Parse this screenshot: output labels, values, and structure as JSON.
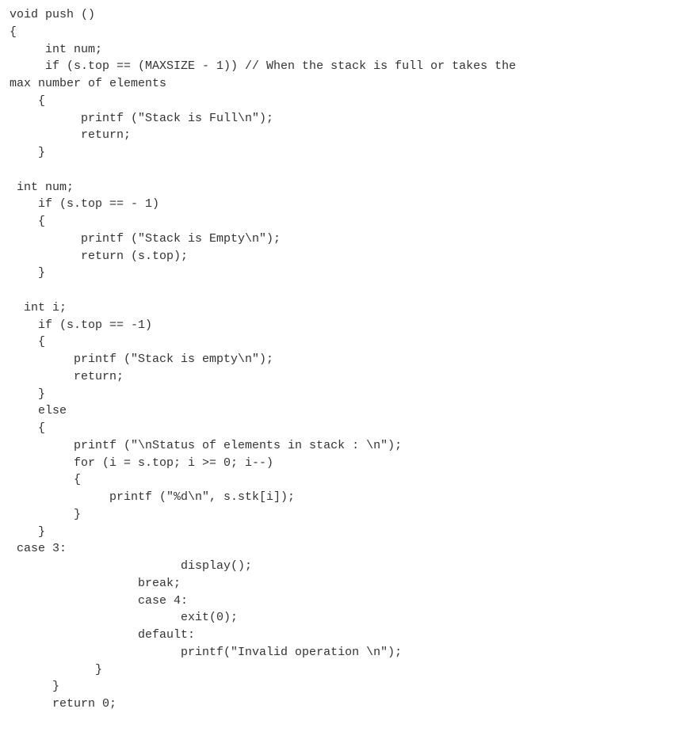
{
  "code": {
    "lines": [
      "void push ()",
      "{",
      "     int num;",
      "     if (s.top == (MAXSIZE - 1)) // When the stack is full or takes the",
      "max number of elements",
      "    {",
      "          printf (\"Stack is Full\\n\");",
      "          return;",
      "    }",
      "",
      " int num;",
      "    if (s.top == - 1)",
      "    {",
      "          printf (\"Stack is Empty\\n\");",
      "          return (s.top);",
      "    }",
      "",
      "  int i;",
      "    if (s.top == -1)",
      "    {",
      "         printf (\"Stack is empty\\n\");",
      "         return;",
      "    }",
      "    else",
      "    {",
      "         printf (\"\\nStatus of elements in stack : \\n\");",
      "         for (i = s.top; i >= 0; i--)",
      "         {",
      "              printf (\"%d\\n\", s.stk[i]);",
      "         }",
      "    }",
      " case 3:",
      "                        display();",
      "                  break;",
      "                  case 4:",
      "                        exit(0);",
      "                  default:",
      "                        printf(\"Invalid operation \\n\");",
      "            }",
      "      }",
      "      return 0;"
    ]
  }
}
